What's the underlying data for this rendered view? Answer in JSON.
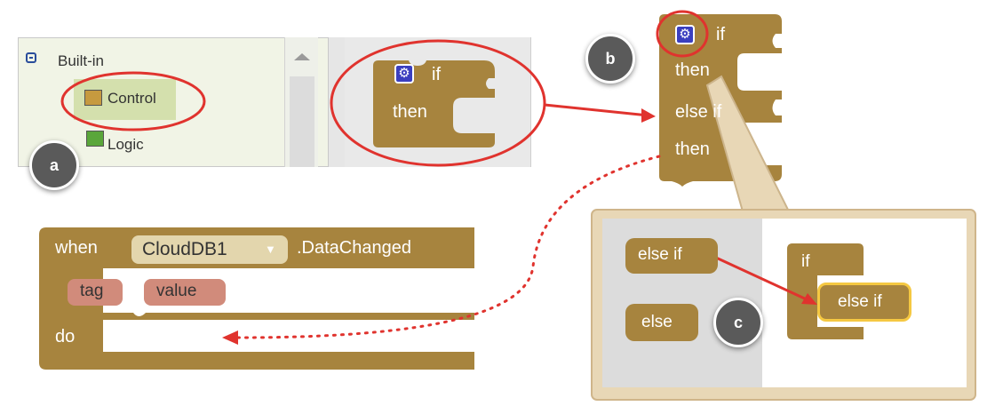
{
  "palette": {
    "section_label": "Built-in",
    "items": [
      {
        "label": "Control",
        "color": "#c69a3f"
      },
      {
        "label": "Logic",
        "color": "#5aa63a"
      }
    ]
  },
  "if_block": {
    "if_label": "if",
    "then_label": "then"
  },
  "expanded_block": {
    "if_label": "if",
    "then_label": "then",
    "else_label": "else if",
    "then2_label": "then"
  },
  "event_block": {
    "when_label": "when",
    "component": "CloudDB1",
    "event": ".DataChanged",
    "params": [
      "tag",
      "value"
    ],
    "do_label": "do"
  },
  "mutator": {
    "left_items": [
      "else if",
      "else"
    ],
    "container_label": "if",
    "dropped_label": "else if"
  },
  "badges": {
    "a": "a",
    "b": "b",
    "c": "c"
  },
  "colors": {
    "block": "#a7843e",
    "highlight": "#e0332e",
    "param": "#d18b7b",
    "dropdown": "#e3d6ad",
    "mutator_frame": "#e3cfae"
  }
}
